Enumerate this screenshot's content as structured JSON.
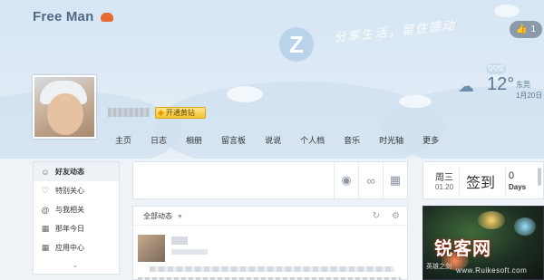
{
  "header": {
    "title": "Free Man",
    "slogan": "分享生活，留住感动",
    "logo_letter": "Z",
    "like_count": "1",
    "like_icon": "thumbs-up-icon",
    "vip_label": "开通黄钻",
    "mini_badge": "QQ空间"
  },
  "weather": {
    "icon": "cloud-rain-icon",
    "temperature": "12°",
    "city": "东莞",
    "date": "1月20日"
  },
  "nav": {
    "items": [
      "主页",
      "日志",
      "相册",
      "留言板",
      "说说",
      "个人档",
      "音乐",
      "时光轴",
      "更多"
    ]
  },
  "sidebar": {
    "items": [
      {
        "label": "好友动态",
        "icon": "user-icon"
      },
      {
        "label": "特别关心",
        "icon": "heart-icon"
      },
      {
        "label": "与我相关",
        "icon": "at-icon"
      },
      {
        "label": "那年今日",
        "icon": "calendar-icon"
      },
      {
        "label": "应用中心",
        "icon": "apps-icon"
      }
    ],
    "more_icon": "chevron-down-icon"
  },
  "publisher": {
    "tools": [
      "camera-icon",
      "link-icon",
      "grid-icon"
    ]
  },
  "feed": {
    "filter_label": "全部动态",
    "refresh_icon": "refresh-icon",
    "settings_icon": "gear-icon"
  },
  "checkin": {
    "weekday": "周三",
    "date": "01.20",
    "button_label": "签到",
    "days_count": "0",
    "days_label": "Days"
  },
  "ad": {
    "watermark": "锐客网",
    "caption": "英雄之剑",
    "url": "www.Ruikesoft.com"
  }
}
